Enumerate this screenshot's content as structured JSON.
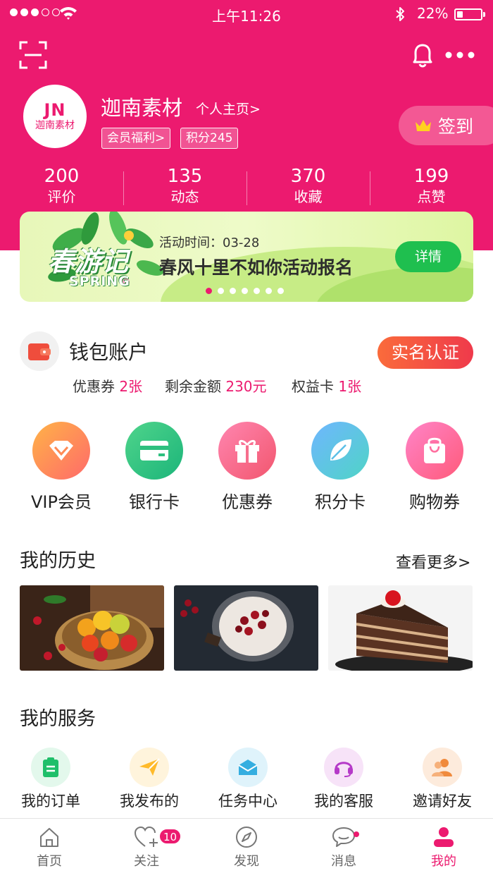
{
  "status_bar": {
    "time": "上午11:26",
    "battery": "22%",
    "battery_level": 0.22
  },
  "header": {
    "scan_icon": "scan-icon",
    "bell_icon": "bell-icon",
    "more_icon": "more-icon"
  },
  "profile": {
    "avatar_letters": "JN",
    "avatar_text": "迦南素材",
    "name": "迦南素材",
    "home_link": "个人主页>",
    "tag_benefit": "会员福利>",
    "tag_points": "积分245",
    "sign_in": "签到"
  },
  "stats": [
    {
      "value": "200",
      "label": "评价"
    },
    {
      "value": "135",
      "label": "动态"
    },
    {
      "value": "370",
      "label": "收藏"
    },
    {
      "value": "199",
      "label": "点赞"
    }
  ],
  "banner": {
    "art_title": "春游记",
    "art_subtitle": "SPRING",
    "time": "活动时间：03-28",
    "headline": "春风十里不如你活动报名",
    "details": "详情",
    "page_count": 7,
    "active_page": 0
  },
  "wallet": {
    "title": "钱包账户",
    "verify": "实名认证",
    "coupon_label": "优惠券",
    "coupon_value": "2张",
    "balance_label": "剩余金额",
    "balance_value": "230元",
    "rights_label": "权益卡",
    "rights_value": "1张"
  },
  "cards": [
    {
      "label": "VIP会员",
      "icon": "diamond-icon"
    },
    {
      "label": "银行卡",
      "icon": "bank-card-icon"
    },
    {
      "label": "优惠券",
      "icon": "gift-icon"
    },
    {
      "label": "积分卡",
      "icon": "leaf-icon"
    },
    {
      "label": "购物券",
      "icon": "shopping-bag-icon"
    }
  ],
  "history": {
    "title": "我的历史",
    "more": "查看更多>",
    "items": [
      "fruit-basket-image",
      "cherry-pavlova-image",
      "black-forest-cake-image"
    ]
  },
  "services": {
    "title": "我的服务",
    "items": [
      {
        "label": "我的订单",
        "icon": "order-icon"
      },
      {
        "label": "我发布的",
        "icon": "paper-plane-icon"
      },
      {
        "label": "任务中心",
        "icon": "envelope-icon"
      },
      {
        "label": "我的客服",
        "icon": "headset-icon"
      },
      {
        "label": "邀请好友",
        "icon": "friends-icon"
      }
    ]
  },
  "tabbar": {
    "items": [
      {
        "label": "首页",
        "icon": "home-icon"
      },
      {
        "label": "关注",
        "icon": "heart-plus-icon"
      },
      {
        "label": "发现",
        "icon": "compass-icon"
      },
      {
        "label": "消息",
        "icon": "chat-icon"
      },
      {
        "label": "我的",
        "icon": "user-icon"
      }
    ],
    "follow_badge": "10",
    "active": "我的"
  }
}
